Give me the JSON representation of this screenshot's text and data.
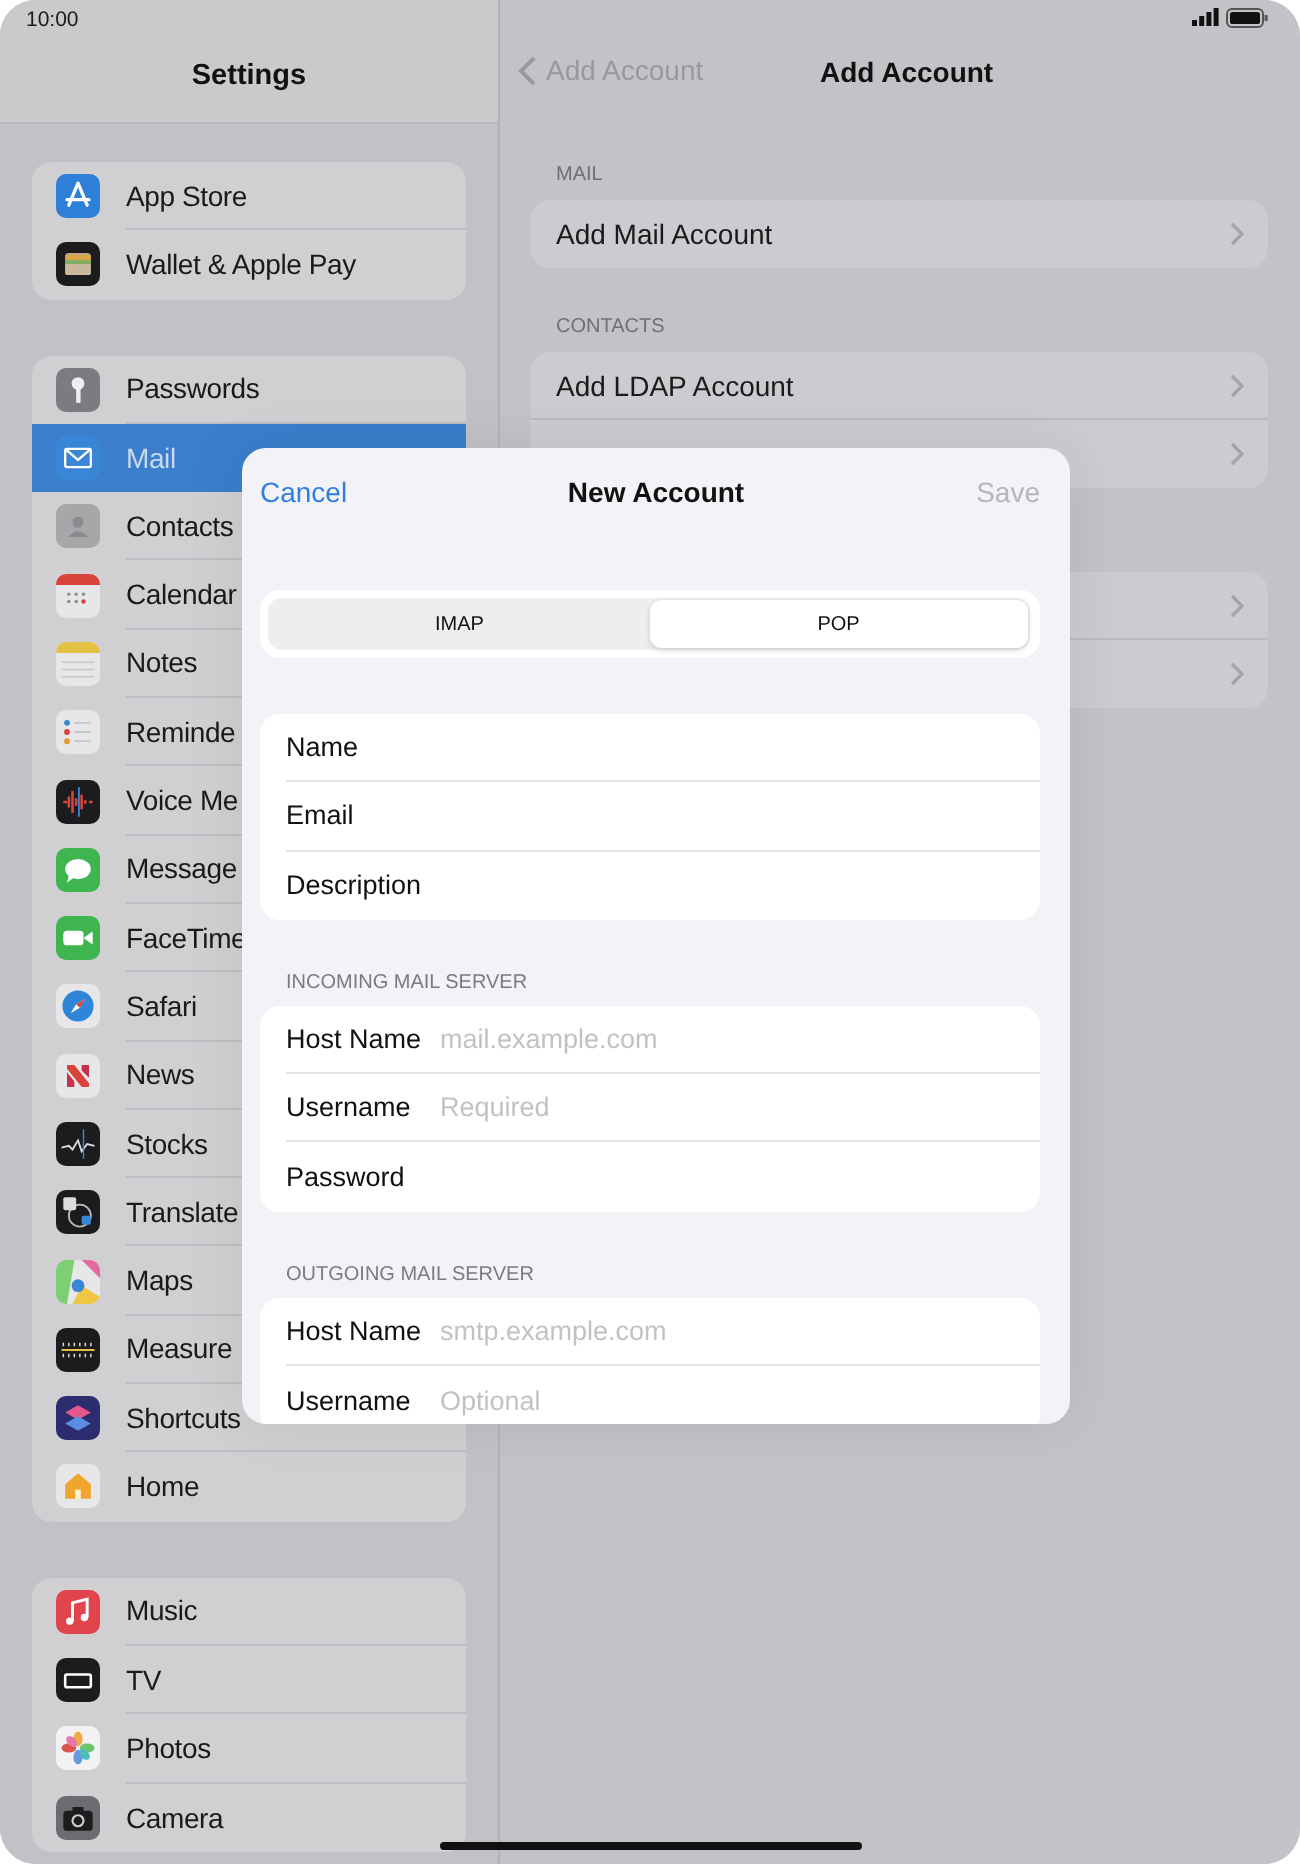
{
  "status_bar": {
    "time": "10:00"
  },
  "sidebar": {
    "title": "Settings",
    "groups": [
      {
        "items": [
          {
            "label": "App Store",
            "selected": false
          },
          {
            "label": "Wallet & Apple Pay",
            "selected": false
          }
        ]
      },
      {
        "items": [
          {
            "label": "Passwords",
            "selected": false
          },
          {
            "label": "Mail",
            "selected": true
          },
          {
            "label": "Contacts",
            "selected": false
          },
          {
            "label": "Calendar",
            "selected": false
          },
          {
            "label": "Notes",
            "selected": false
          },
          {
            "label": "Reminde",
            "selected": false
          },
          {
            "label": "Voice Me",
            "selected": false
          },
          {
            "label": "Message",
            "selected": false
          },
          {
            "label": "FaceTime",
            "selected": false
          },
          {
            "label": "Safari",
            "selected": false
          },
          {
            "label": "News",
            "selected": false
          },
          {
            "label": "Stocks",
            "selected": false
          },
          {
            "label": "Translate",
            "selected": false
          },
          {
            "label": "Maps",
            "selected": false
          },
          {
            "label": "Measure",
            "selected": false
          },
          {
            "label": "Shortcuts",
            "selected": false
          },
          {
            "label": "Home",
            "selected": false
          }
        ]
      },
      {
        "items": [
          {
            "label": "Music",
            "selected": false
          },
          {
            "label": "TV",
            "selected": false
          },
          {
            "label": "Photos",
            "selected": false
          },
          {
            "label": "Camera",
            "selected": false
          }
        ]
      }
    ]
  },
  "detail": {
    "back": "Add Account",
    "title": "Add Account",
    "sections": [
      {
        "header": "MAIL",
        "rows": [
          {
            "label": "Add Mail Account"
          }
        ]
      },
      {
        "header": "CONTACTS",
        "rows": [
          {
            "label": "Add LDAP Account"
          },
          {}
        ]
      },
      {
        "rows": [
          {},
          {}
        ]
      }
    ]
  },
  "sheet": {
    "cancel": "Cancel",
    "title": "New Account",
    "save": {
      "label": "Save",
      "disabled": true
    },
    "segments": [
      {
        "label": "IMAP",
        "selected": false
      },
      {
        "label": "POP",
        "selected": true
      }
    ],
    "groups": [
      {
        "rows": [
          {
            "label": "Name"
          },
          {
            "label": "Email"
          },
          {
            "label": "Description"
          }
        ]
      },
      {
        "header": "INCOMING MAIL SERVER",
        "rows": [
          {
            "label": "Host Name",
            "placeholder": "mail.example.com"
          },
          {
            "label": "Username",
            "placeholder": "Required"
          },
          {
            "label": "Password"
          }
        ]
      },
      {
        "header": "OUTGOING MAIL SERVER",
        "rows": [
          {
            "label": "Host Name",
            "placeholder": "smtp.example.com"
          },
          {
            "label": "Username",
            "placeholder": "Optional"
          }
        ]
      }
    ]
  }
}
